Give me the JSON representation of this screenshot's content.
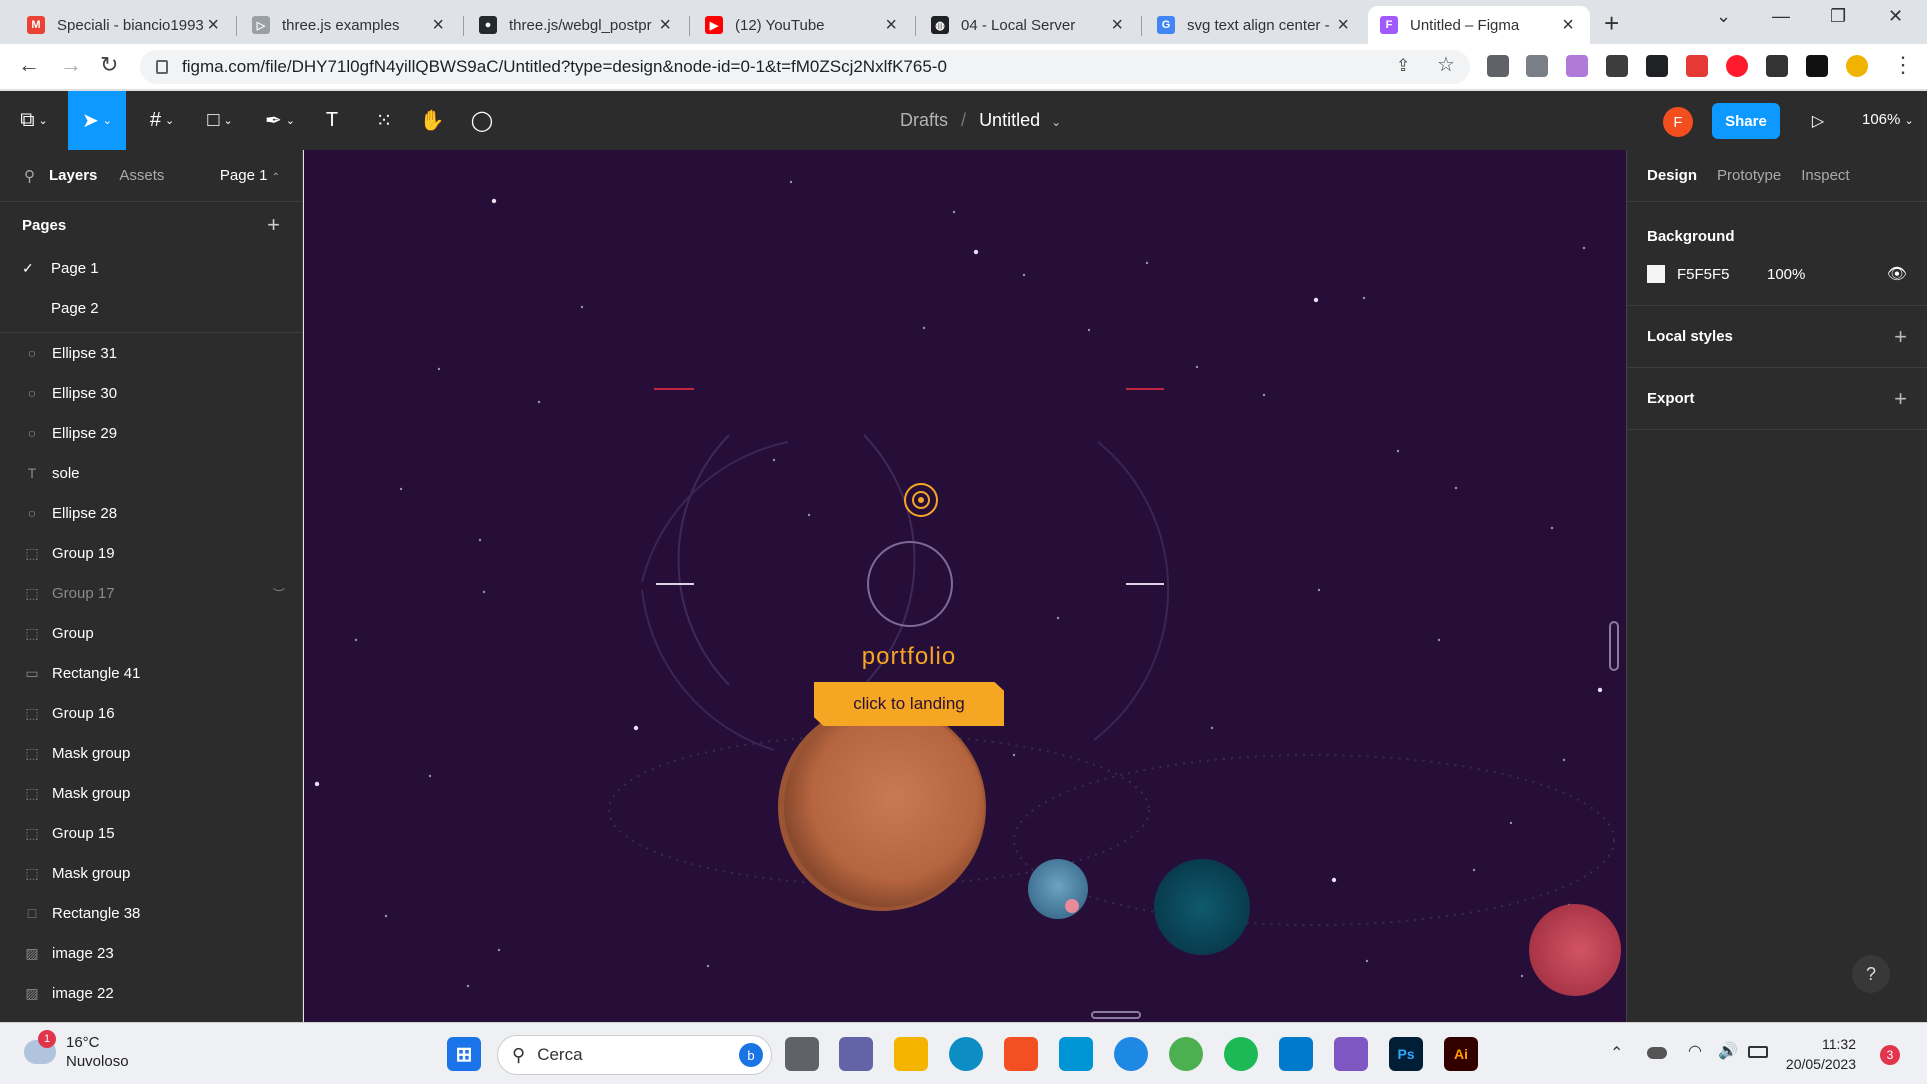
{
  "browser": {
    "tabs": [
      {
        "title": "Speciali - biancio1993",
        "favicon_color": "#ea4335",
        "favicon": "M"
      },
      {
        "title": "three.js examples",
        "favicon_color": "#9aa0a6",
        "favicon": "▷"
      },
      {
        "title": "three.js/webgl_postpr",
        "favicon_color": "#24292f",
        "favicon": "●"
      },
      {
        "title": "(12) YouTube",
        "favicon_color": "#ff0000",
        "favicon": "▶"
      },
      {
        "title": "04 - Local Server",
        "favicon_color": "#202124",
        "favicon": "◍"
      },
      {
        "title": "svg text align center -",
        "favicon_color": "#4285f4",
        "favicon": "G"
      },
      {
        "title": "Untitled – Figma",
        "favicon_color": "#a259ff",
        "favicon": "F"
      }
    ],
    "url": "figma.com/file/DHY71l0gfN4yillQBWS9aC/Untitled?type=design&node-id=0-1&t=fM0ZScj2NxlfK765-0"
  },
  "figma": {
    "breadcrumb": {
      "parent": "Drafts",
      "sep": "/",
      "file": "Untitled"
    },
    "avatar_letter": "F",
    "share_label": "Share",
    "zoom": "106%",
    "left": {
      "tab_layers": "Layers",
      "tab_assets": "Assets",
      "page_selector": "Page 1",
      "pages_title": "Pages",
      "pages": [
        "Page 1",
        "Page 2"
      ],
      "layers": [
        {
          "name": "Ellipse 31",
          "icon": "○"
        },
        {
          "name": "Ellipse 30",
          "icon": "○"
        },
        {
          "name": "Ellipse 29",
          "icon": "○"
        },
        {
          "name": "sole",
          "icon": "T"
        },
        {
          "name": "Ellipse 28",
          "icon": "○"
        },
        {
          "name": "Group 19",
          "icon": "⬚"
        },
        {
          "name": "Group 17",
          "icon": "⬚",
          "hidden": true
        },
        {
          "name": "Group",
          "icon": "⬚"
        },
        {
          "name": "Rectangle 41",
          "icon": "▭"
        },
        {
          "name": "Group 16",
          "icon": "⬚"
        },
        {
          "name": "Mask group",
          "icon": "⬚"
        },
        {
          "name": "Mask group",
          "icon": "⬚"
        },
        {
          "name": "Group 15",
          "icon": "⬚"
        },
        {
          "name": "Mask group",
          "icon": "⬚"
        },
        {
          "name": "Rectangle 38",
          "icon": "□"
        },
        {
          "name": "image 23",
          "icon": "▨"
        },
        {
          "name": "image 22",
          "icon": "▨"
        }
      ]
    },
    "canvas": {
      "title": "portfolio",
      "button": "click to landing",
      "bg_color": "#260e39",
      "accent": "#f5a623"
    },
    "right": {
      "tabs": [
        "Design",
        "Prototype",
        "Inspect"
      ],
      "background_label": "Background",
      "bg_hex": "F5F5F5",
      "bg_opacity": "100%",
      "local_styles": "Local styles",
      "export": "Export"
    }
  },
  "taskbar": {
    "weather_temp": "16°C",
    "weather_desc": "Nuvoloso",
    "weather_badge": "1",
    "search": "Cerca",
    "time": "11:32",
    "date": "20/05/2023",
    "notif_count": "3"
  }
}
